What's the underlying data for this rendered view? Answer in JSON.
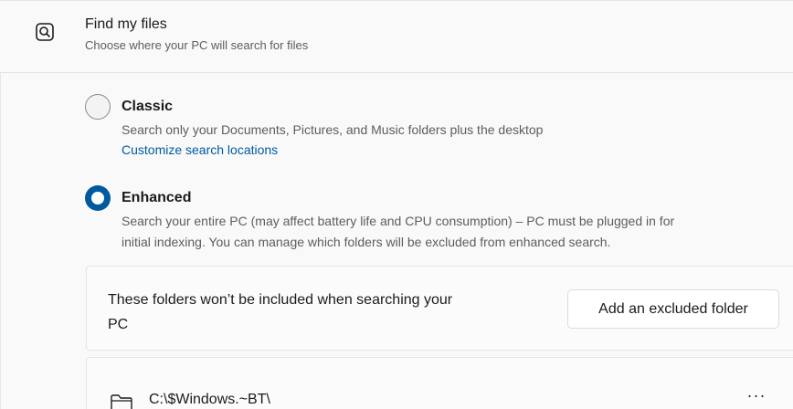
{
  "header": {
    "icon": "search-icon",
    "title": "Find my files",
    "subtitle": "Choose where your PC will search for files"
  },
  "options": {
    "classic": {
      "label": "Classic",
      "description": "Search only your Documents, Pictures, and Music folders plus the desktop",
      "link": "Customize search locations",
      "selected": false
    },
    "enhanced": {
      "label": "Enhanced",
      "description_line1": "Search your entire PC (may affect battery life and CPU consumption) – PC must be plugged in for",
      "description_line2": "initial indexing. You can manage which folders will be excluded from enhanced search.",
      "selected": true
    }
  },
  "excluded": {
    "text_line1": "These folders won’t be included when searching your",
    "text_line2": "PC",
    "add_button": "Add an excluded folder"
  },
  "folders": [
    {
      "icon": "folder-icon",
      "path": "C:\\$Windows.~BT\\",
      "more": "···"
    }
  ],
  "colors": {
    "accent": "#005a9e",
    "background": "#f3f3f3",
    "card": "#f9f9f9"
  }
}
